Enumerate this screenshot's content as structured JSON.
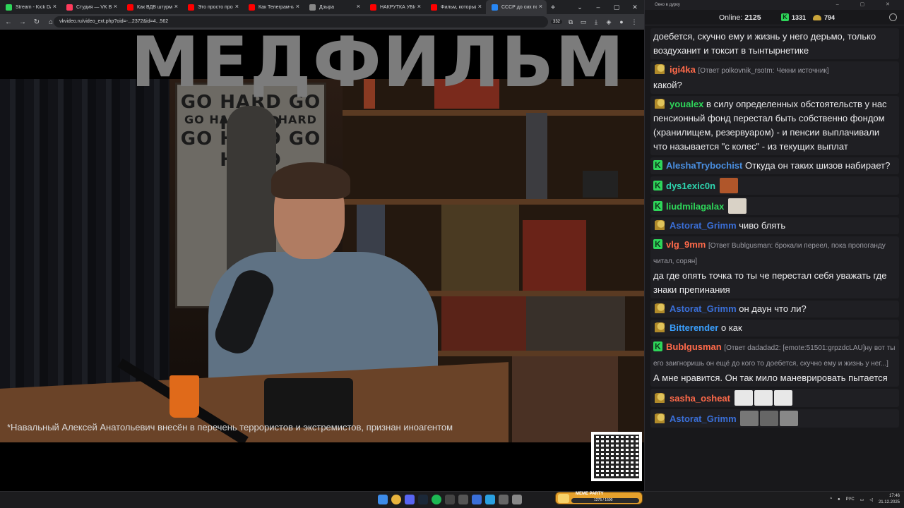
{
  "browser": {
    "tabs": [
      {
        "title": "Stream - Kick Dash",
        "color": "#2ed65a"
      },
      {
        "title": "Студия — VK Видео",
        "color": "#ff3b5c"
      },
      {
        "title": "Как ВДВ штурмуют",
        "color": "#ff0000"
      },
      {
        "title": "Это просто провал",
        "color": "#ff0000"
      },
      {
        "title": "Как Телеграм-кана",
        "color": "#ff0000"
      },
      {
        "title": "Дзыра",
        "color": "#888888"
      },
      {
        "title": "НАКРУТКА УБИВАЕ",
        "color": "#ff0000"
      },
      {
        "title": "Фильм, который с",
        "color": "#ff0000"
      },
      {
        "title": "СССР до сих по",
        "color": "#2787f5"
      }
    ],
    "url": "vkvideo.ru/video_ext.php?oid=-...2372&id=4...562",
    "address_badge": "332"
  },
  "video": {
    "title_overlay": "МЕДФИЛЬМ",
    "poster_lines": [
      "GO HARD GO HARD",
      "GO HARD GO HARD",
      "GO HARD GO HARD"
    ],
    "disclaimer": "*Навальный Алексей Анатольевич внесён в перечень террористов и экстремистов, признан иноагентом"
  },
  "chat": {
    "window_title": "Окно в дурку",
    "online_label": "Online:",
    "online_count": "2125",
    "kick_count": "1331",
    "hat_count": "794",
    "messages": [
      {
        "badge": "hat",
        "user": "",
        "user_color": "#ececee",
        "reply": "",
        "text": "доебется, скучно ему и жизнь у него дерьмо, только воздуханит и токсит в тынтырнетике"
      },
      {
        "badge": "hat",
        "user": "igi4ka",
        "user_color": "#ff6a4a",
        "reply": "[Ответ polkovnik_rsotm: Чекни источник]",
        "text": "какой?"
      },
      {
        "badge": "hat",
        "user": "youalex",
        "user_color": "#2ed65a",
        "reply": "",
        "text": "в силу определенных обстоятельств у нас пенсионный фонд перестал быть собственно фондом (хранилищем, резервуаром)  - и пенсии выплачивали что называется \"с колес\" - из текущих выплат"
      },
      {
        "badge": "k",
        "user": "AleshaTrybochist",
        "user_color": "#4a90e2",
        "reply": "",
        "text": "Откуда он таких шизов набирает?"
      },
      {
        "badge": "k",
        "user": "dys1exic0n",
        "user_color": "#2ed6b0",
        "reply": "",
        "text": ""
      },
      {
        "badge": "k",
        "user": "liudmilagalax",
        "user_color": "#2ed65a",
        "reply": "",
        "text": ""
      },
      {
        "badge": "hat",
        "user": "Astorat_Grimm",
        "user_color": "#3a6fd8",
        "reply": "",
        "text": "чиво блять"
      },
      {
        "badge": "k",
        "user": "vlg_9mm",
        "user_color": "#ff6a4a",
        "reply": "[Ответ Bublgusman: брокали переел, пока пропоганду читал, сорян]",
        "text": "да где опять точка то ты че перестал себя уважать где знаки препинания"
      },
      {
        "badge": "hat",
        "user": "Astorat_Grimm",
        "user_color": "#3a6fd8",
        "reply": "",
        "text": "он даун что ли?"
      },
      {
        "badge": "hat",
        "user": "Bitterender",
        "user_color": "#3aa0ff",
        "reply": "",
        "text": "о как"
      },
      {
        "badge": "k",
        "user": "Bublgusman",
        "user_color": "#ff6a4a",
        "reply": "[Ответ dadadad2: [emote:51501:grpzdcLAU]ну вот ты его заигноришь он ещё до кого то доебется, скучно ему и жизнь у нег...]",
        "text": "А мне нравится. Он так мило маневрировать пытается"
      },
      {
        "badge": "hat",
        "user": "sasha_osheat",
        "user_color": "#ff6a4a",
        "reply": "",
        "text": ""
      },
      {
        "badge": "hat",
        "user": "Astorat_Grimm",
        "user_color": "#3a6fd8",
        "reply": "",
        "text": ""
      }
    ]
  },
  "taskbar": {
    "lang": "РУС",
    "time": "17:46",
    "date": "21.12.2025",
    "meme_label": "MEME PARTY",
    "meme_count": "1275 / 1500"
  }
}
